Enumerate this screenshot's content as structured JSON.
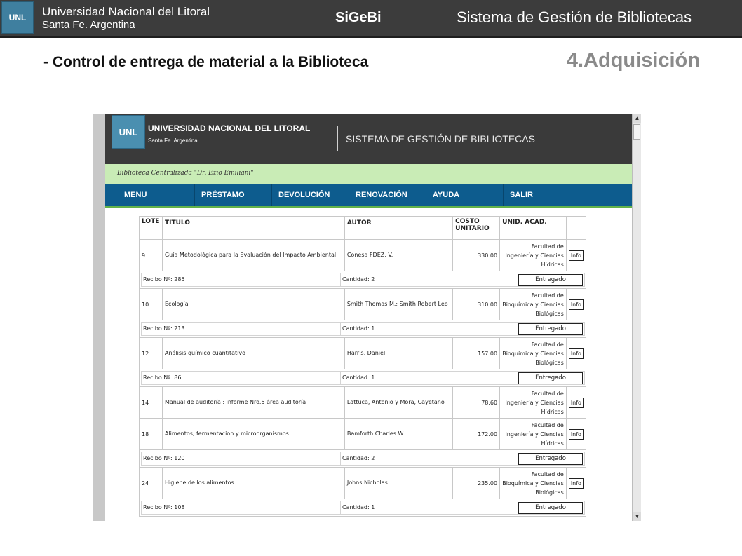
{
  "slide": {
    "header": {
      "logo": "UNL",
      "university": "Universidad Nacional del Litoral",
      "city": "Santa Fe. Argentina",
      "app": "SiGeBi",
      "system": "Sistema de Gestión de Bibliotecas"
    },
    "title": "- Control de entrega de material a la Biblioteca",
    "section": "4.Adquisición"
  },
  "site": {
    "logo": "UNL",
    "university": "UNIVERSIDAD NACIONAL DEL LITORAL",
    "city": "Santa Fe. Argentina",
    "system": "SISTEMA DE GESTIÓN DE BIBLIOTECAS",
    "library": "Biblioteca Centralizada \"Dr. Ezio Emiliani\"",
    "nav": [
      "MENU",
      "PRÉSTAMO",
      "DEVOLUCIÓN",
      "RENOVACIÓN",
      "AYUDA",
      "SALIR"
    ]
  },
  "table": {
    "headers": [
      "LOTE",
      "TITULO",
      "AUTOR",
      "COSTO UNITARIO",
      "UNID. ACAD."
    ],
    "info_label": "Info",
    "entregado_label": "Entregado",
    "items": [
      {
        "lote": "9",
        "titulo": "Guía Metodológica para la Evaluación del Impacto Ambiental",
        "autor": "Conesa FDEZ, V.",
        "costo": "330.00",
        "unidad": "Facultad de Ingeniería y Ciencias Hídricas"
      },
      {
        "lote": "10",
        "titulo": "Ecología",
        "autor": "Smith Thomas M.; Smith Robert Leo",
        "costo": "310.00",
        "unidad": "Facultad de Bioquímica y Ciencias Biológicas"
      },
      {
        "lote": "12",
        "titulo": "Análisis químico cuantitativo",
        "autor": "Harris, Daniel",
        "costo": "157.00",
        "unidad": "Facultad de Bioquímica y Ciencias Biológicas"
      },
      {
        "lote": "14",
        "titulo": "Manual de auditoría : informe Nro.5 área auditoría",
        "autor": "Lattuca, Antonio y Mora, Cayetano",
        "costo": "78.60",
        "unidad": "Facultad de Ingeniería y Ciencias Hídricas"
      },
      {
        "lote": "18",
        "titulo": "Alimentos, fermentacion y microorganismos",
        "autor": "Bamforth Charles W.",
        "costo": "172.00",
        "unidad": "Facultad de Ingeniería y Ciencias Hídricas"
      },
      {
        "lote": "24",
        "titulo": "Higiene de los alimentos",
        "autor": "Johns Nicholas",
        "costo": "235.00",
        "unidad": "Facultad de Bioquímica y Ciencias Biológicas"
      }
    ],
    "receipts": [
      {
        "recibo": "Recibo Nº: 285",
        "cantidad": "Cantidad: 2"
      },
      {
        "recibo": "Recibo Nº: 213",
        "cantidad": "Cantidad: 1"
      },
      {
        "recibo": "Recibo Nº: 86",
        "cantidad": "Cantidad: 1"
      },
      {
        "recibo": "Recibo Nº: 120",
        "cantidad": "Cantidad: 2"
      },
      {
        "recibo": "Recibo Nº: 108",
        "cantidad": "Cantidad: 1"
      }
    ]
  }
}
